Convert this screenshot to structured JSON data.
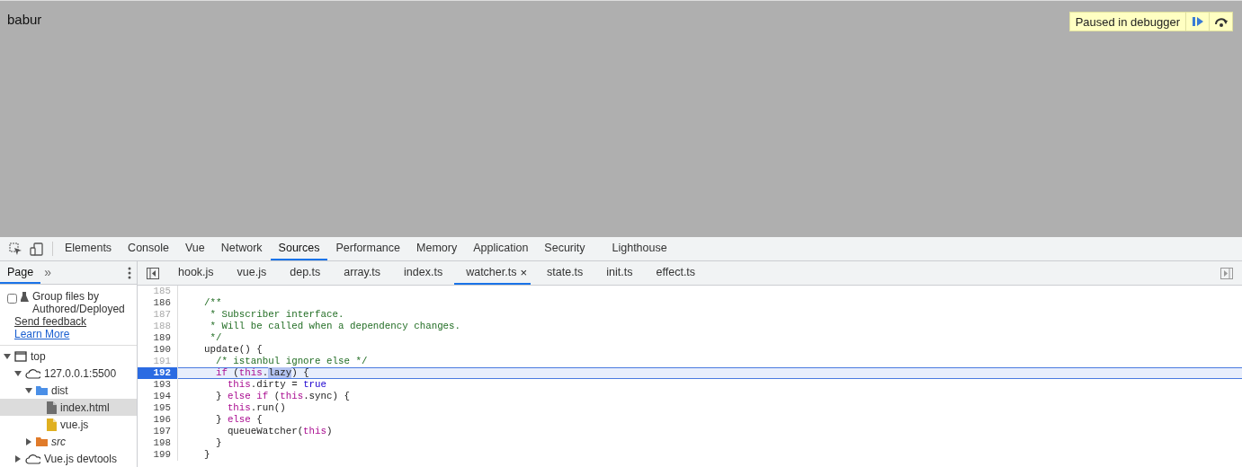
{
  "page": {
    "heading": "babur",
    "paused_overlay": {
      "label": "Paused in debugger"
    }
  },
  "devtools": {
    "tabs": [
      {
        "label": "Elements",
        "selected": false
      },
      {
        "label": "Console",
        "selected": false
      },
      {
        "label": "Vue",
        "selected": false
      },
      {
        "label": "Network",
        "selected": false
      },
      {
        "label": "Sources",
        "selected": true
      },
      {
        "label": "Performance",
        "selected": false
      },
      {
        "label": "Memory",
        "selected": false
      },
      {
        "label": "Application",
        "selected": false
      },
      {
        "label": "Security",
        "selected": false
      },
      {
        "label": "Lighthouse",
        "selected": false
      }
    ],
    "navigator": {
      "tab": {
        "label": "Page",
        "selected": true
      },
      "more": "»",
      "group_option": {
        "label": "Group files by Authored/Deployed",
        "checked": false
      },
      "links": [
        "Send feedback",
        "Learn More"
      ],
      "tree": [
        {
          "label": "top",
          "kind": "frame",
          "expanded": true,
          "selected": false,
          "children": [
            {
              "label": "127.0.0.1:5500",
              "kind": "cloud",
              "expanded": true,
              "selected": false,
              "children": [
                {
                  "label": "dist",
                  "kind": "folder",
                  "color": "#4a8fe7",
                  "expanded": true,
                  "selected": false,
                  "children": [
                    {
                      "label": "index.html",
                      "kind": "file",
                      "color": "#6e6e6e",
                      "selected": true
                    },
                    {
                      "label": "vue.js",
                      "kind": "file",
                      "color": "#e0b020",
                      "selected": false
                    }
                  ]
                },
                {
                  "label": "src",
                  "kind": "folder",
                  "color": "#e07b2a",
                  "expanded": false,
                  "selected": false
                }
              ]
            },
            {
              "label": "Vue.js devtools",
              "kind": "cloud",
              "expanded": false,
              "selected": false
            }
          ]
        }
      ]
    },
    "file_tabs": [
      {
        "label": "hook.js",
        "selected": false
      },
      {
        "label": "vue.js",
        "selected": false
      },
      {
        "label": "dep.ts",
        "selected": false
      },
      {
        "label": "array.ts",
        "selected": false
      },
      {
        "label": "index.ts",
        "selected": false
      },
      {
        "label": "watcher.ts",
        "selected": true,
        "close": "×"
      },
      {
        "label": "state.ts",
        "selected": false
      },
      {
        "label": "init.ts",
        "selected": false
      },
      {
        "label": "effect.ts",
        "selected": false
      }
    ],
    "code": [
      {
        "number": "185",
        "dimmed": true,
        "paused": false
      },
      {
        "number": "186",
        "dimmed": false,
        "paused": false,
        "tokens": [
          {
            "kind": "comment",
            "text": "  /**"
          }
        ]
      },
      {
        "number": "187",
        "dimmed": true,
        "paused": false,
        "tokens": [
          {
            "kind": "comment",
            "text": "   * Subscriber interface."
          }
        ]
      },
      {
        "number": "188",
        "dimmed": true,
        "paused": false,
        "tokens": [
          {
            "kind": "comment",
            "text": "   * Will be called when a dependency changes."
          }
        ]
      },
      {
        "number": "189",
        "dimmed": false,
        "paused": false,
        "tokens": [
          {
            "kind": "comment",
            "text": "   */"
          }
        ]
      },
      {
        "number": "190",
        "dimmed": false,
        "paused": false,
        "tokens": [
          {
            "kind": "plain",
            "text": "  update() {"
          }
        ]
      },
      {
        "number": "191",
        "dimmed": true,
        "paused": false,
        "tokens": [
          {
            "kind": "comment",
            "text": "    /* istanbul ignore else */"
          }
        ]
      },
      {
        "number": "192",
        "dimmed": false,
        "paused": true,
        "tokens": [
          {
            "kind": "keyword",
            "text": "    if"
          },
          {
            "kind": "plain",
            "text": " ("
          },
          {
            "kind": "keyword",
            "text": "this"
          },
          {
            "kind": "plain",
            "text": "."
          },
          {
            "kind": "selection",
            "text": "lazy"
          },
          {
            "kind": "plain",
            "text": ") {"
          }
        ]
      },
      {
        "number": "193",
        "dimmed": false,
        "paused": false,
        "tokens": [
          {
            "kind": "keyword",
            "text": "      this"
          },
          {
            "kind": "plain",
            "text": ".dirty = "
          },
          {
            "kind": "literal",
            "text": "true"
          }
        ]
      },
      {
        "number": "194",
        "dimmed": false,
        "paused": false,
        "tokens": [
          {
            "kind": "plain",
            "text": "    } "
          },
          {
            "kind": "keyword",
            "text": "else if"
          },
          {
            "kind": "plain",
            "text": " ("
          },
          {
            "kind": "keyword",
            "text": "this"
          },
          {
            "kind": "plain",
            "text": ".sync) {"
          }
        ]
      },
      {
        "number": "195",
        "dimmed": false,
        "paused": false,
        "tokens": [
          {
            "kind": "keyword",
            "text": "      this"
          },
          {
            "kind": "plain",
            "text": ".run()"
          }
        ]
      },
      {
        "number": "196",
        "dimmed": false,
        "paused": false,
        "tokens": [
          {
            "kind": "plain",
            "text": "    } "
          },
          {
            "kind": "keyword",
            "text": "else"
          },
          {
            "kind": "plain",
            "text": " {"
          }
        ]
      },
      {
        "number": "197",
        "dimmed": false,
        "paused": false,
        "tokens": [
          {
            "kind": "plain",
            "text": "      queueWatcher("
          },
          {
            "kind": "keyword",
            "text": "this"
          },
          {
            "kind": "plain",
            "text": ")"
          }
        ]
      },
      {
        "number": "198",
        "dimmed": false,
        "paused": false,
        "tokens": [
          {
            "kind": "plain",
            "text": "    }"
          }
        ]
      },
      {
        "number": "199",
        "dimmed": false,
        "paused": false,
        "tokens": [
          {
            "kind": "plain",
            "text": "  }"
          }
        ]
      }
    ]
  }
}
